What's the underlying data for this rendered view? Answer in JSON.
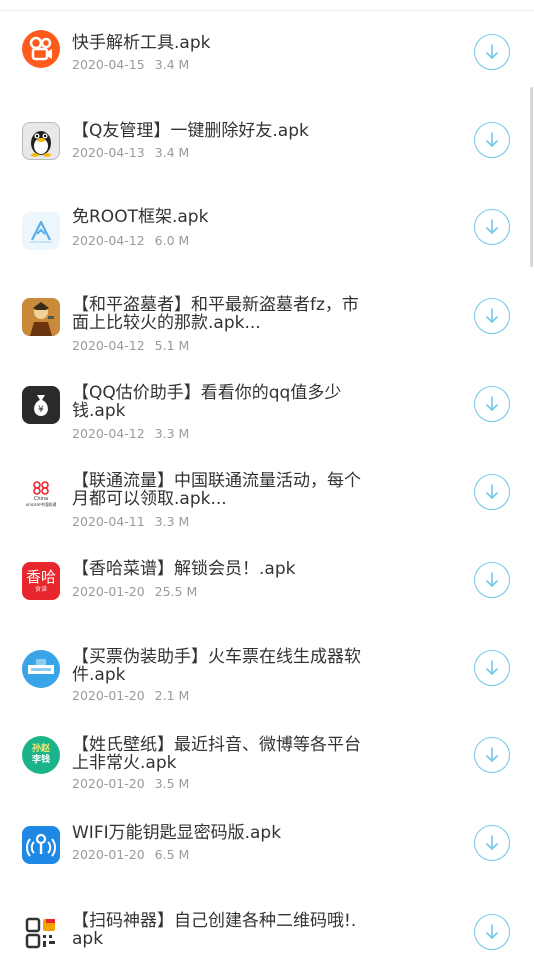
{
  "files": [
    {
      "title": "快手解析工具.apk",
      "date": "2020-04-15",
      "size": "3.4 M",
      "icon": "kuaishou-icon",
      "color": "#ff5b1c"
    },
    {
      "title": "【Q友管理】一键删除好友.apk",
      "date": "2020-04-13",
      "size": "3.4 M",
      "icon": "qq-penguin-icon",
      "color": "#555555"
    },
    {
      "title": "免ROOT框架.apk",
      "date": "2020-04-12",
      "size": "6.0 M",
      "icon": "virtual-framework-icon",
      "color": "#5aaee8"
    },
    {
      "title": "【和平盗墓者】和平最新盗墓者fz，市面上比较火的那款.apk...",
      "date": "2020-04-12",
      "size": "5.1 M",
      "icon": "game-character-icon",
      "color": "#c9731c"
    },
    {
      "title": "【QQ估价助手】看看你的qq值多少钱.apk",
      "date": "2020-04-12",
      "size": "3.3 M",
      "icon": "money-bag-icon",
      "color": "#2a2a2a"
    },
    {
      "title": "【联通流量】中国联通流量活动，每个月都可以领取.apk...",
      "date": "2020-04-11",
      "size": "3.3 M",
      "icon": "china-unicom-icon",
      "color": "#e8262d"
    },
    {
      "title": "【香哈菜谱】解锁会员！.apk",
      "date": "2020-01-20",
      "size": "25.5 M",
      "icon": "xiangha-icon",
      "color": "#e8262d"
    },
    {
      "title": "【买票伪装助手】火车票在线生成器软件.apk",
      "date": "2020-01-20",
      "size": "2.1 M",
      "icon": "ticket-icon",
      "color": "#3aa4e8"
    },
    {
      "title": "【姓氏壁纸】最近抖音、微博等各平台上非常火.apk",
      "date": "2020-01-20",
      "size": "3.5 M",
      "icon": "wallpaper-icon",
      "color": "#1bb38a"
    },
    {
      "title": "WIFI万能钥匙显密码版.apk",
      "date": "2020-01-20",
      "size": "6.5 M",
      "icon": "wifi-key-icon",
      "color": "#1e88e5"
    },
    {
      "title": "【扫码神器】自己创建各种二维码哦!.apk",
      "date": "",
      "size": "",
      "icon": "qr-code-icon",
      "color": "#333333"
    }
  ],
  "icon_text": {
    "money_bag": "¥",
    "china_unicom_cn": "China",
    "china_unicom_en": "unicom中国联通",
    "xiangha_main": "香哈",
    "xiangha_sub": "食谱",
    "wallpaper_line1": "孙赵",
    "wallpaper_line2": "李钱"
  },
  "colors": {
    "accent": "#73c6e8",
    "meta_text": "#9a9a9a",
    "title_text": "#333333"
  }
}
